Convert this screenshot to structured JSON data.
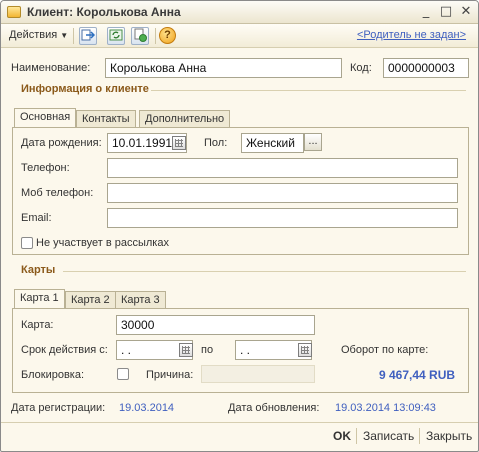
{
  "window": {
    "title": "Клиент: Королькова Анна",
    "buttons": [
      "_",
      "□",
      "✕"
    ]
  },
  "toolbar": {
    "actions_label": "Действия",
    "parent_link": "<Родитель не задан>"
  },
  "form": {
    "name_label": "Наименование:",
    "name_value": "Королькова Анна",
    "code_label": "Код:",
    "code_value": "0000000003"
  },
  "client_info": {
    "title": "Информация о клиенте",
    "tabs": [
      "Основная",
      "Контакты",
      "Дополнительно"
    ],
    "birth_label": "Дата рождения:",
    "birth_value": "10.01.1991",
    "gender_label": "Пол:",
    "gender_value": "Женский",
    "gender_button": "...",
    "phone_label": "Телефон:",
    "phone_value": "",
    "mobile_label": "Моб телефон:",
    "mobile_value": "",
    "email_label": "Email:",
    "email_value": "",
    "newsletter_label": "Не участвует в рассылках"
  },
  "cards": {
    "title": "Карты",
    "tabs": [
      "Карта 1",
      "Карта 2",
      "Карта 3"
    ],
    "card_label": "Карта:",
    "card_value": "30000",
    "validity_label": "Срок действия с:",
    "validity_from": " .  .",
    "to_label": "по",
    "validity_to": " .  .",
    "turnover_label": "Оборот по карте:",
    "turnover_value": "9 467,44 RUB",
    "block_label": "Блокировка:",
    "reason_label": "Причина:"
  },
  "dates": {
    "reg_label": "Дата регистрации:",
    "reg_value": "19.03.2014",
    "upd_label": "Дата обновления:",
    "upd_value": "19.03.2014 13:09:43"
  },
  "footer": {
    "ok": "OK",
    "save": "Записать",
    "close": "Закрыть"
  },
  "colors": {
    "accent_link": "#3f5fbf",
    "section_title": "#8b5a1b",
    "background": "#fcf8ec"
  }
}
